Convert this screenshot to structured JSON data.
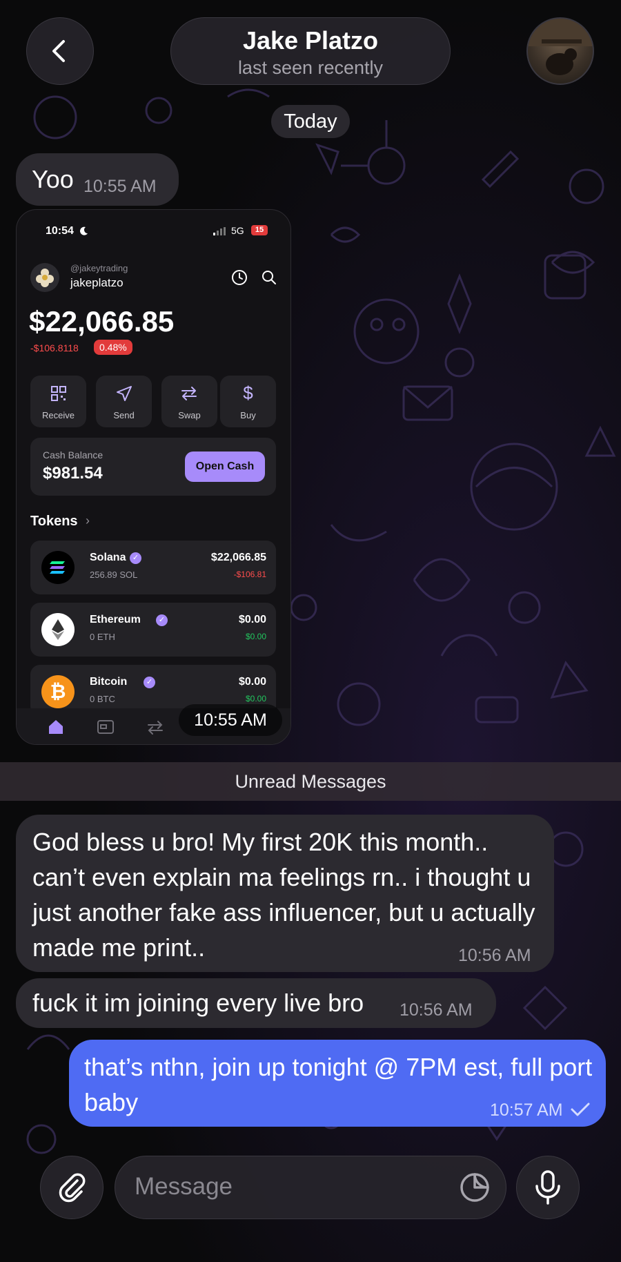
{
  "header": {
    "contact_name": "Jake Platzo",
    "status": "last seen recently"
  },
  "date_chip": "Today",
  "messages": [
    {
      "text": "Yoo",
      "time": "10:55 AM"
    },
    {
      "time": "10:55 AM"
    },
    {
      "text": "God bless u bro! My first 20K this month.. can’t even explain ma feelings rn.. i thought u just another fake ass influencer, but u actually made me print..",
      "time": "10:56 AM"
    },
    {
      "text": "fuck it im joining every live bro",
      "time": "10:56 AM"
    },
    {
      "text": "that’s nthn, join up tonight @ 7PM est, full port baby",
      "time": "10:57 AM"
    }
  ],
  "unread_label": "Unread Messages",
  "photo": {
    "status_time": "10:54",
    "network": "5G",
    "battery": "15",
    "handle": "@jakeytrading",
    "username": "jakeplatzo",
    "balance": "$22,066.85",
    "change": "-$106.8118",
    "change_pct": "0.48%",
    "actions": [
      "Receive",
      "Send",
      "Swap",
      "Buy"
    ],
    "cash_label": "Cash Balance",
    "cash_value": "$981.54",
    "open_cash": "Open Cash",
    "tokens_label": "Tokens",
    "tokens_chevron": "›",
    "tokens": [
      {
        "name": "Solana",
        "amount": "256.89 SOL",
        "value": "$22,066.85",
        "delta": "-$106.81"
      },
      {
        "name": "Ethereum",
        "amount": "0 ETH",
        "value": "$0.00",
        "delta": "$0.00"
      },
      {
        "name": "Bitcoin",
        "amount": "0 BTC",
        "value": "$0.00",
        "delta": "$0.00"
      }
    ]
  },
  "input": {
    "placeholder": "Message"
  },
  "colors": {
    "outgoing_bubble": "#4f6bf3",
    "incoming_bubble": "#2c2a30",
    "accent_purple": "#a78bfa",
    "negative_red": "#ff4d4d",
    "positive_green": "#22c55e"
  },
  "icons": [
    "back-chevron-icon",
    "paperclip-icon",
    "sticker-icon",
    "microphone-icon",
    "check-icon"
  ]
}
